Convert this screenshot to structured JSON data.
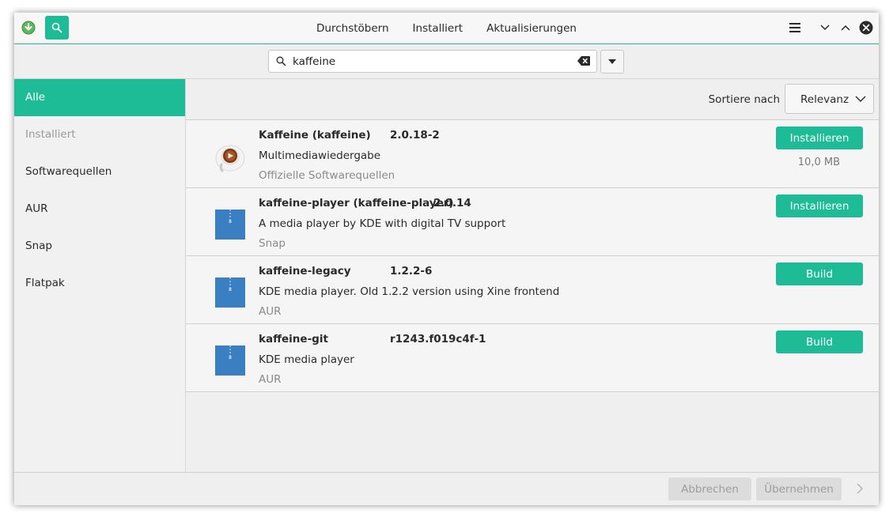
{
  "header": {
    "tabs": [
      {
        "label": "Durchstöbern"
      },
      {
        "label": "Installiert"
      },
      {
        "label": "Aktualisierungen"
      }
    ]
  },
  "search": {
    "value": "kaffeine"
  },
  "sidebar": {
    "items": [
      {
        "label": "Alle",
        "state": "active"
      },
      {
        "label": "Installiert",
        "state": "disabled"
      },
      {
        "label": "Softwarequellen"
      },
      {
        "label": "AUR"
      },
      {
        "label": "Snap"
      },
      {
        "label": "Flatpak"
      }
    ]
  },
  "sort": {
    "label": "Sortiere nach",
    "value": "Relevanz"
  },
  "packages": [
    {
      "name": "Kaffeine (kaffeine)",
      "version": "2.0.18-2",
      "description": "Multimediawiedergabe",
      "repo": "Offizielle Softwarequellen",
      "action": "Installieren",
      "size": "10,0 MB",
      "icon": "kaffeine-app-icon"
    },
    {
      "name": "kaffeine-player (kaffeine-player)",
      "version": "2.0.14",
      "description": "A media player by KDE with digital TV support",
      "repo": "Snap",
      "action": "Installieren",
      "icon": "package-icon"
    },
    {
      "name": "kaffeine-legacy",
      "version": "1.2.2-6",
      "description": "KDE media player. Old 1.2.2 version using Xine frontend",
      "repo": "AUR",
      "action": "Build",
      "icon": "package-icon"
    },
    {
      "name": "kaffeine-git",
      "version": "r1243.f019c4f-1",
      "description": "KDE media player",
      "repo": "AUR",
      "action": "Build",
      "icon": "package-icon"
    }
  ],
  "footer": {
    "cancel_label": "Abbrechen",
    "apply_label": "Übernehmen"
  },
  "colors": {
    "accent": "#1dbb96",
    "package_blue": "#3a7fc1"
  }
}
